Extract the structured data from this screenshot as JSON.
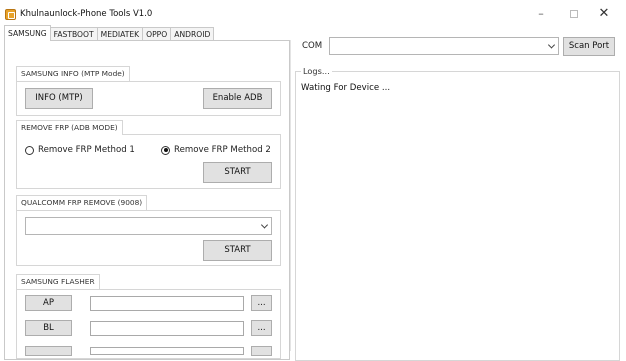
{
  "window": {
    "title": "Khulnaunlock-Phone Tools V1.0",
    "minimize_glyph": "–",
    "close_glyph": "✕"
  },
  "tabs": [
    "SAMSUNG",
    "FASTBOOT",
    "MEDIATEK",
    "OPPO",
    "ANDROID"
  ],
  "active_tab": "SAMSUNG",
  "samsung_info": {
    "title": "SAMSUNG INFO (MTP Mode)",
    "info_button": "INFO (MTP)",
    "adb_button": "Enable ADB"
  },
  "remove_frp": {
    "title": "REMOVE FRP (ADB MODE)",
    "method1": "Remove FRP Method 1",
    "method2": "Remove FRP Method 2",
    "selected": "method2",
    "start_button": "START"
  },
  "qualcomm": {
    "title": "QUALCOMM FRP REMOVE (9008)",
    "select_value": "",
    "start_button": "START"
  },
  "flasher": {
    "title": "SAMSUNG FLASHER",
    "rows": [
      {
        "label": "AP",
        "path": "",
        "browse": "..."
      },
      {
        "label": "BL",
        "path": "",
        "browse": "..."
      },
      {
        "label": "",
        "path": "",
        "browse": ""
      }
    ]
  },
  "connection": {
    "com_label": "COM",
    "com_value": "",
    "scan_button": "Scan Port"
  },
  "logs": {
    "title": "Logs...",
    "message": "Wating For Device ..."
  }
}
